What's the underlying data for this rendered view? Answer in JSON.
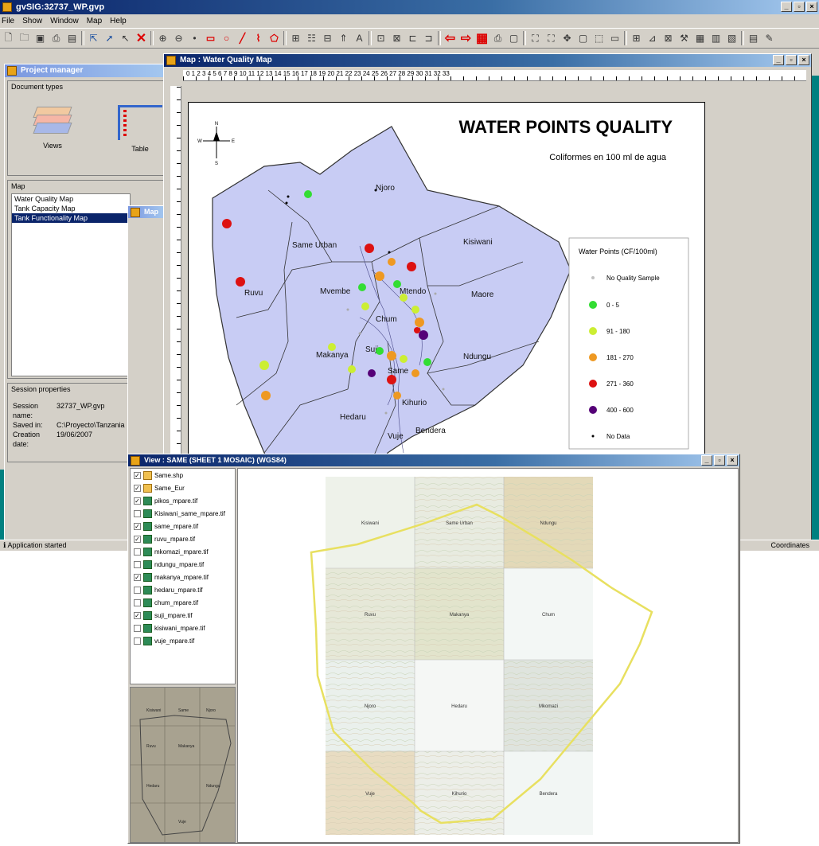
{
  "app": {
    "title": "gvSIG:32737_WP.gvp",
    "menu": [
      "File",
      "Show",
      "Window",
      "Map",
      "Help"
    ],
    "window_controls": [
      "_",
      "▫",
      "×"
    ]
  },
  "project_manager": {
    "title": "Project manager",
    "document_types_label": "Document types",
    "doc_types": [
      "Views",
      "Table"
    ],
    "map_label": "Map",
    "maps": [
      "Water Quality Map",
      "Tank Capacity Map",
      "Tank Functionality Map"
    ],
    "selected_map": "Tank Functionality Map",
    "session_label": "Session properties",
    "session": [
      {
        "key": "Session name:",
        "value": "32737_WP.gvp"
      },
      {
        "key": "Saved in:",
        "value": "C:\\Proyecto\\Tanzania"
      },
      {
        "key": "Creation date:",
        "value": "19/06/2007"
      }
    ]
  },
  "small_window": {
    "title": "Map"
  },
  "map_window": {
    "title": "Map : Water Quality Map",
    "ruler_numbers": "0 1 2 3 4 5 6 7 8 9 10 11 12 13 14 15 16 17 18 19 20 21 22 23 24 25 26 27 28 29 30 31 32 33",
    "map_title": "WATER POINTS QUALITY",
    "map_subtitle": "Coliformes en 100 ml de agua",
    "north_labels": {
      "n": "N",
      "w": "W",
      "e": "E",
      "s": "S"
    },
    "place_names": [
      "Njoro",
      "Same Urban",
      "Kisiwani",
      "Mvembe",
      "Ruvu",
      "Mtendo",
      "Maore",
      "Chum",
      "Makanya",
      "Ndungu",
      "Hedaru",
      "Vuje",
      "Bendera",
      "Kihurio",
      "Same",
      "Suji"
    ],
    "legend_title": "Water Points (CF/100ml)",
    "legend": [
      {
        "label": "No Quality Sample",
        "color": "#c0c0c0",
        "size": 3
      },
      {
        "label": "0 - 5",
        "color": "#33dd33",
        "size": 10
      },
      {
        "label": "91 - 180",
        "color": "#ccee33",
        "size": 10
      },
      {
        "label": "181 - 270",
        "color": "#ee9922",
        "size": 10
      },
      {
        "label": "271 - 360",
        "color": "#dd1111",
        "size": 10
      },
      {
        "label": "400 - 600",
        "color": "#550077",
        "size": 10
      },
      {
        "label": "No Data",
        "color": "#000000",
        "size": 3
      }
    ]
  },
  "status": {
    "left": "Application started",
    "right": "Coordinates"
  },
  "view_window": {
    "title": "View : SAME (SHEET 1 MOSAIC) (WGS84)",
    "layers": [
      {
        "name": "Same.shp",
        "checked": true,
        "type": "shp"
      },
      {
        "name": "Same_Eur",
        "checked": true,
        "type": "shp"
      },
      {
        "name": "pikos_mpare.tif",
        "checked": true,
        "type": "tif"
      },
      {
        "name": "Kisiwani_same_mpare.tif",
        "checked": false,
        "type": "tif"
      },
      {
        "name": "same_mpare.tif",
        "checked": true,
        "type": "tif"
      },
      {
        "name": "ruvu_mpare.tif",
        "checked": true,
        "type": "tif"
      },
      {
        "name": "mkomazi_mpare.tif",
        "checked": false,
        "type": "tif"
      },
      {
        "name": "ndungu_mpare.tif",
        "checked": false,
        "type": "tif"
      },
      {
        "name": "makanya_mpare.tif",
        "checked": true,
        "type": "tif"
      },
      {
        "name": "hedaru_mpare.tif",
        "checked": false,
        "type": "tif"
      },
      {
        "name": "chum_mpare.tif",
        "checked": false,
        "type": "tif"
      },
      {
        "name": "suji_mpare.tif",
        "checked": true,
        "type": "tif"
      },
      {
        "name": "kisiwani_mpare.tif",
        "checked": false,
        "type": "tif"
      },
      {
        "name": "vuje_mpare.tif",
        "checked": false,
        "type": "tif"
      }
    ],
    "tiles": [
      "Kisiwani",
      "Same Urban",
      "Ndungu",
      "Ruvu",
      "Makanya",
      "Chum",
      "Njoro",
      "Hedaru",
      "Mkomazi",
      "Vuje",
      "Kihurio",
      "Bendera"
    ],
    "locator_labels": [
      "Kisiwani",
      "Same",
      "Njoro",
      "Ruvu",
      "Makanya",
      "Hedaru",
      "Ndungu",
      "Vuje"
    ]
  }
}
